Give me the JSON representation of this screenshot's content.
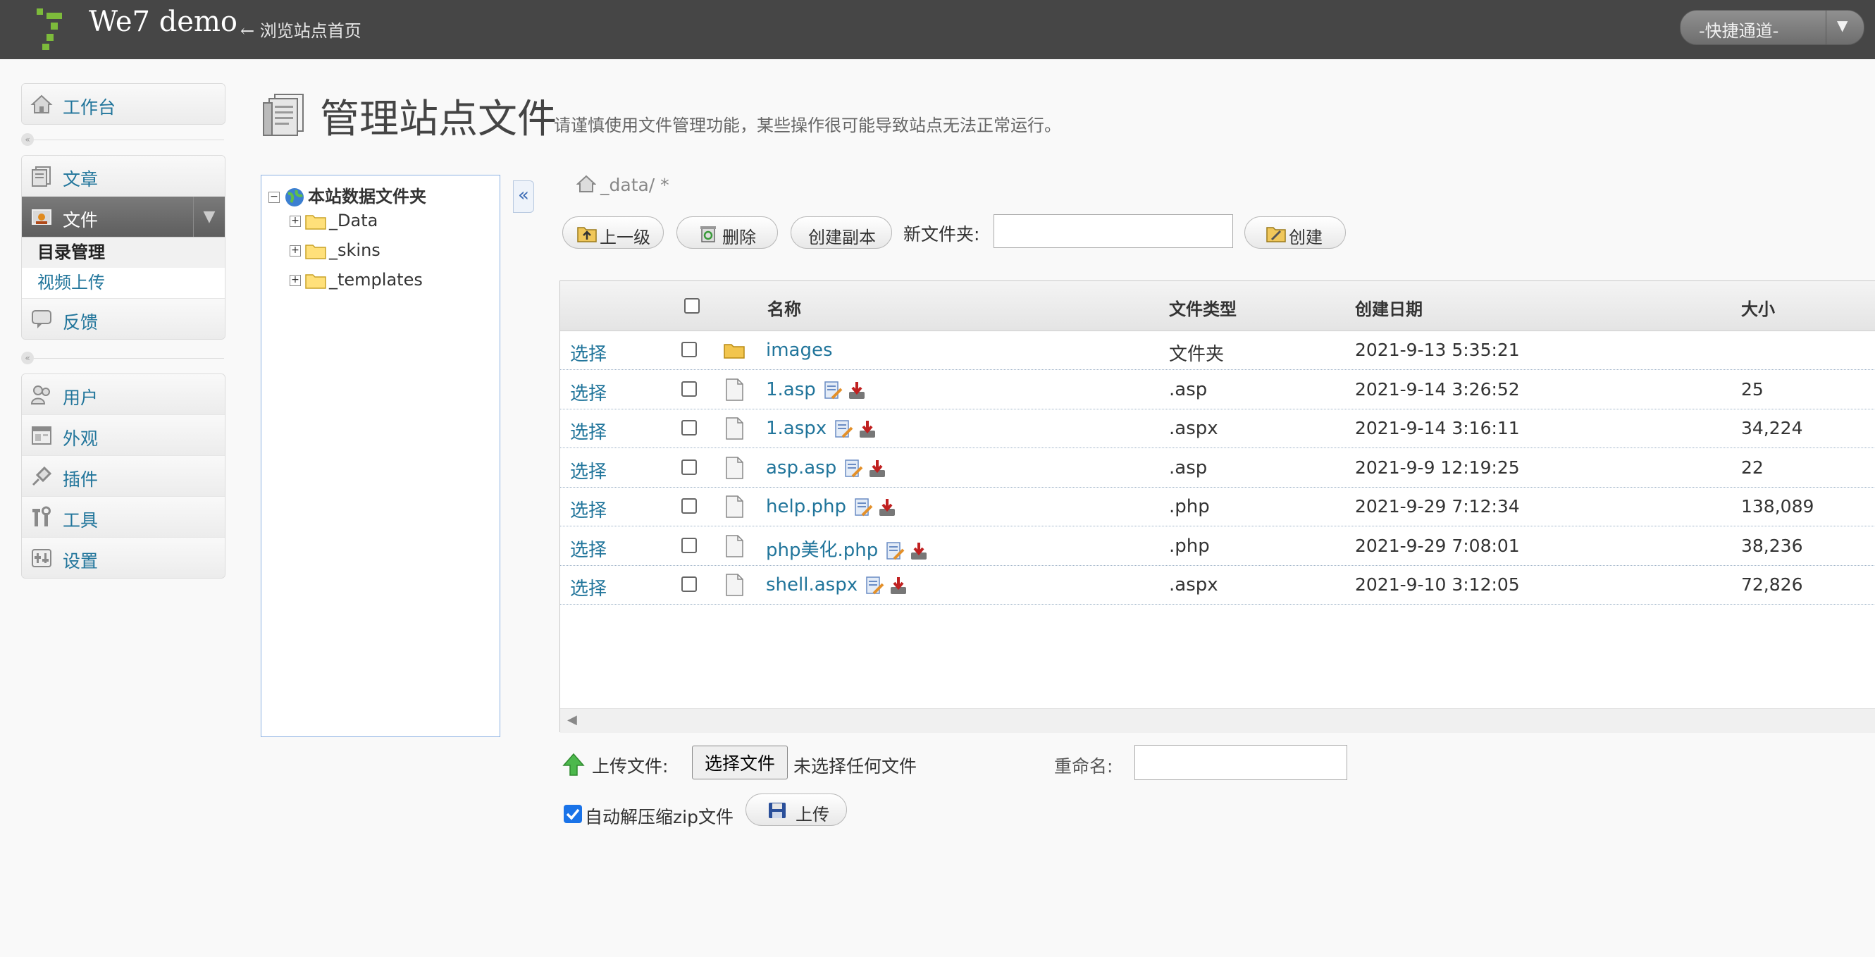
{
  "header": {
    "site_title": "We7 demo",
    "site_link": "← 浏览站点首页",
    "quick_menu": "-快捷通道-"
  },
  "sidebar": {
    "group1": [
      {
        "label": "工作台",
        "icon": "dashboard-icon"
      }
    ],
    "group2": [
      {
        "label": "文章",
        "icon": "article-icon"
      },
      {
        "label": "文件",
        "icon": "file-icon",
        "active": true
      },
      {
        "label": "反馈",
        "icon": "feedback-icon"
      }
    ],
    "file_submenu": [
      {
        "label": "目录管理",
        "current": true
      },
      {
        "label": "视频上传"
      }
    ],
    "group3": [
      {
        "label": "用户",
        "icon": "users-icon"
      },
      {
        "label": "外观",
        "icon": "appearance-icon"
      },
      {
        "label": "插件",
        "icon": "plugin-icon"
      },
      {
        "label": "工具",
        "icon": "tools-icon"
      },
      {
        "label": "设置",
        "icon": "settings-icon"
      }
    ]
  },
  "page": {
    "title": "管理站点文件",
    "note": "请谨慎使用文件管理功能，某些操作很可能导致站点无法正常运行。"
  },
  "tree": {
    "root": "本站数据文件夹",
    "folders": [
      "_Data",
      "_skins",
      "_templates"
    ],
    "expand_glyph": "«"
  },
  "breadcrumb": {
    "path": "_data/  *"
  },
  "toolbar": {
    "up": "上一级",
    "delete": "删除",
    "copy": "创建副本",
    "new_folder_label": "新文件夹:",
    "create": "创建"
  },
  "table": {
    "headers": {
      "name": "名称",
      "type": "文件类型",
      "date": "创建日期",
      "size": "大小"
    },
    "rows": [
      {
        "select": "选择",
        "name": "images",
        "is_folder": true,
        "type": "文件夹",
        "date": "2021-9-13 5:35:21",
        "size": ""
      },
      {
        "select": "选择",
        "name": "1.asp",
        "is_folder": false,
        "type": ".asp",
        "date": "2021-9-14 3:26:52",
        "size": "25"
      },
      {
        "select": "选择",
        "name": "1.aspx",
        "is_folder": false,
        "type": ".aspx",
        "date": "2021-9-14 3:16:11",
        "size": "34,224"
      },
      {
        "select": "选择",
        "name": "asp.asp",
        "is_folder": false,
        "type": ".asp",
        "date": "2021-9-9 12:19:25",
        "size": "22"
      },
      {
        "select": "选择",
        "name": "help.php",
        "is_folder": false,
        "type": ".php",
        "date": "2021-9-29 7:12:34",
        "size": "138,089"
      },
      {
        "select": "选择",
        "name": "php美化.php",
        "is_folder": false,
        "type": ".php",
        "date": "2021-9-29 7:08:01",
        "size": "38,236"
      },
      {
        "select": "选择",
        "name": "shell.aspx",
        "is_folder": false,
        "type": ".aspx",
        "date": "2021-9-10 3:12:05",
        "size": "72,826"
      }
    ]
  },
  "upload": {
    "label": "上传文件:",
    "choose": "选择文件",
    "no_file": "未选择任何文件",
    "rename_label": "重命名:",
    "unzip_label": "自动解压缩zip文件",
    "unzip_checked": true,
    "upload_button": "上传"
  },
  "colors": {
    "link": "#21759b",
    "header_bg": "#464646",
    "accent_checkbox": "#1a73e8"
  }
}
